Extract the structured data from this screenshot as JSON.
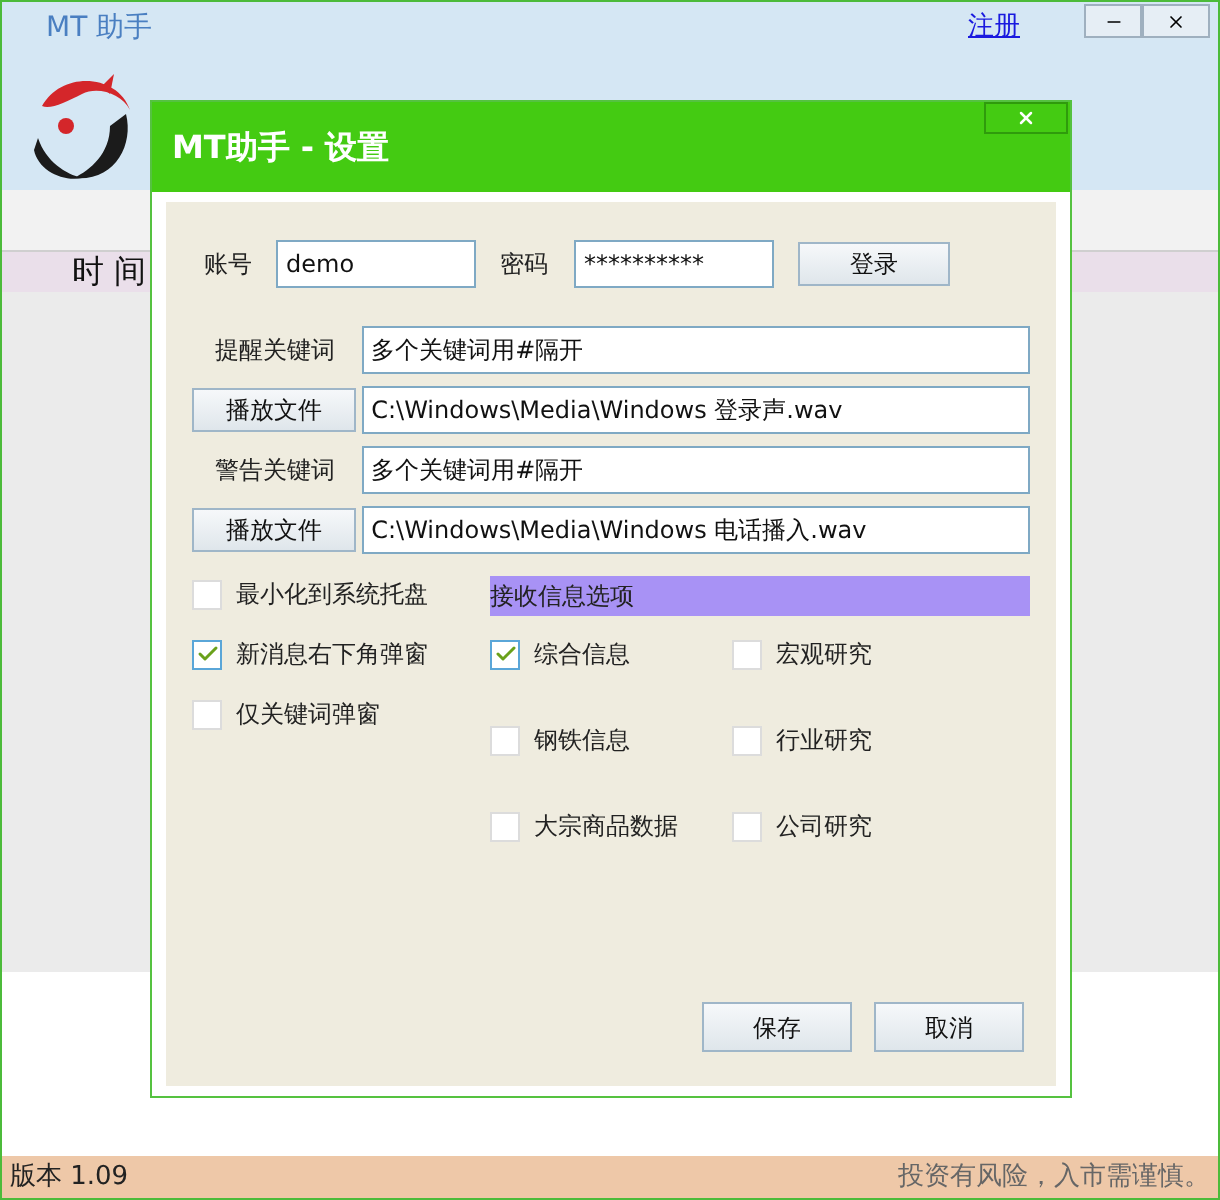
{
  "window": {
    "title": "MT 助手",
    "register_link": "注册"
  },
  "table_header": {
    "label": "时 间"
  },
  "dialog": {
    "title": "MT助手 - 设置",
    "account": {
      "label": "账号",
      "value": "demo"
    },
    "password": {
      "label": "密码",
      "value": "**********"
    },
    "login_button": "登录",
    "alert_rows": [
      {
        "label": "提醒关键词",
        "keywords": "多个关键词用#隔开",
        "play_button": "播放文件",
        "file": "C:\\Windows\\Media\\Windows 登录声.wav"
      },
      {
        "label": "警告关键词",
        "keywords": "多个关键词用#隔开",
        "play_button": "播放文件",
        "file": "C:\\Windows\\Media\\Windows 电话播入.wav"
      }
    ],
    "options": [
      {
        "label": "最小化到系统托盘",
        "checked": false
      },
      {
        "label": "新消息右下角弹窗",
        "checked": true
      },
      {
        "label": "仅关键词弹窗",
        "checked": false
      }
    ],
    "receive": {
      "title": "接收信息选项",
      "items": [
        {
          "label": "综合信息",
          "checked": true
        },
        {
          "label": "宏观研究",
          "checked": false
        },
        {
          "label": "钢铁信息",
          "checked": false
        },
        {
          "label": "行业研究",
          "checked": false
        },
        {
          "label": "大宗商品数据",
          "checked": false
        },
        {
          "label": "公司研究",
          "checked": false
        }
      ]
    },
    "buttons": [
      "保存",
      "取消"
    ]
  },
  "status_bar": {
    "version": "版本 1.09",
    "notice": "投资有风险，入市需谨慎。"
  }
}
